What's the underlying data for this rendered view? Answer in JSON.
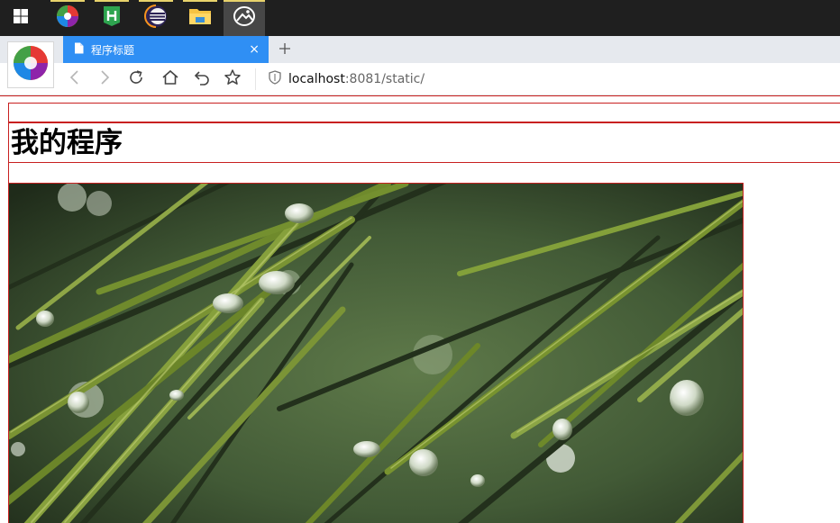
{
  "taskbar": {
    "apps": [
      {
        "icon": "windows-start-icon"
      },
      {
        "icon": "browser-swirl-icon"
      },
      {
        "icon": "hbuilder-icon"
      },
      {
        "icon": "eclipse-icon"
      },
      {
        "icon": "file-explorer-icon"
      },
      {
        "icon": "photos-app-icon"
      }
    ]
  },
  "browser": {
    "tab_title": "程序标题",
    "new_tab_symbol": "+",
    "close_symbol": "×",
    "address_host": "localhost",
    "address_rest": ":8081/static/",
    "accent": "#2f8ff4"
  },
  "page": {
    "heading": "我的程序",
    "outline_color": "#c82020",
    "image": {
      "subject": "pine-needles-with-water-droplets"
    }
  }
}
